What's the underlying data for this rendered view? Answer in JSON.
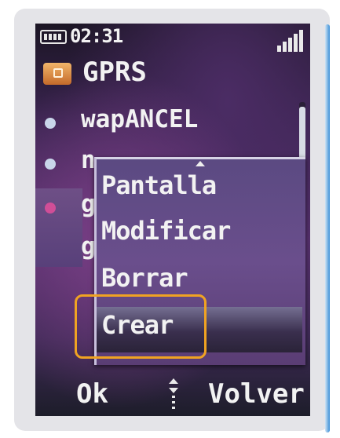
{
  "status_bar": {
    "time": "02:31",
    "battery_icon": "battery-icon",
    "signal_icon": "signal-strength-icon"
  },
  "header": {
    "icon": "folder-icon",
    "title": "GPRS"
  },
  "list": {
    "items": [
      {
        "label": "wapANCEL"
      },
      {
        "label": "n"
      },
      {
        "label": "g"
      },
      {
        "label": "g"
      }
    ]
  },
  "popup_menu": {
    "items": [
      {
        "label": "Pantalla"
      },
      {
        "label": "Modificar"
      },
      {
        "label": "Borrar"
      },
      {
        "label": "Crear"
      }
    ],
    "selected": "Crear"
  },
  "softkeys": {
    "left": "Ok",
    "right": "Volver"
  },
  "colors": {
    "highlight_annotation": "#f0a322",
    "selected_bullet": "#d04e97"
  }
}
